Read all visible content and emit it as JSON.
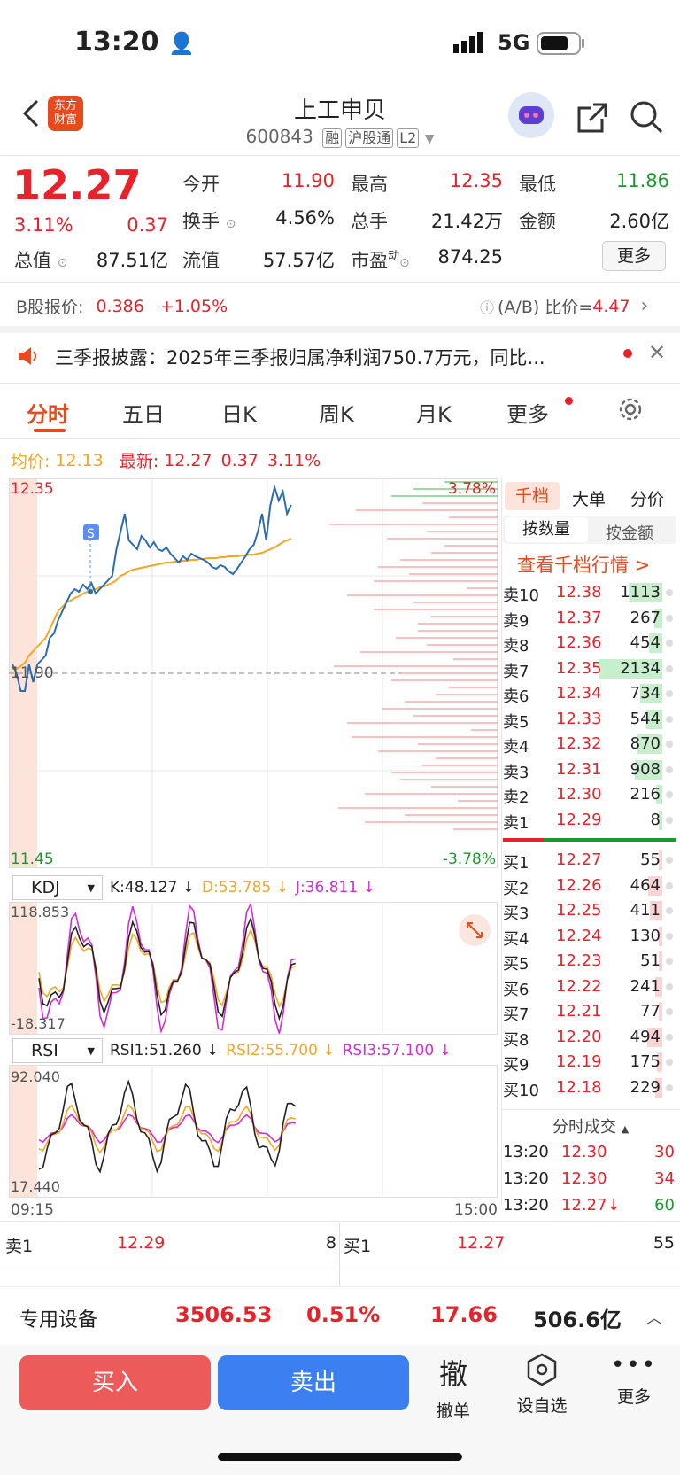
{
  "status": {
    "time": "13:20",
    "network": "5G"
  },
  "header": {
    "logo": "东方\n财富",
    "title": "上工申贝",
    "code": "600843",
    "tags": [
      "融",
      "沪股通",
      "L2"
    ]
  },
  "quote": {
    "price": "12.27",
    "pct": "3.11%",
    "chg": "0.37",
    "open_label": "今开",
    "open": "11.90",
    "high_label": "最高",
    "high": "12.35",
    "low_label": "最低",
    "low": "11.86",
    "turnover_label": "换手",
    "turnover": "4.56%",
    "volume_label": "总手",
    "volume": "21.42万",
    "amount_label": "金额",
    "amount": "2.60亿",
    "mktcap_label": "总值",
    "mktcap": "87.51亿",
    "float_label": "流值",
    "float": "57.57亿",
    "pe_label": "市盈",
    "pe_sup": "动",
    "pe": "874.25",
    "more_label": "更多"
  },
  "bshare": {
    "label": "B股报价:",
    "price": "0.386",
    "pct": "+1.05%",
    "ratio_label": "(A/B) 比价=",
    "ratio": "4.47"
  },
  "notice": {
    "text": "三季报披露：2025年三季报归属净利润750.7万元，同比..."
  },
  "tabs": [
    "分时",
    "五日",
    "日K",
    "周K",
    "月K",
    "更多"
  ],
  "chart_info": {
    "avg_label": "均价:",
    "avg": "12.13",
    "last_label": "最新:",
    "last": "12.27",
    "chg": "0.37",
    "pct": "3.11%"
  },
  "chart_axis": {
    "top": "12.35",
    "mid": "11.90",
    "bottom": "11.45",
    "top_pct": "3.78%",
    "bottom_pct": "-3.78%",
    "t_start": "09:15",
    "t_end": "15:00"
  },
  "kdj": {
    "name": "KDJ",
    "k": "K:48.127 ↓",
    "d": "D:53.785 ↓",
    "j": "J:36.811 ↓",
    "max": "118.853",
    "min": "-18.317"
  },
  "rsi": {
    "name": "RSI",
    "r1": "RSI1:51.260 ↓",
    "r2": "RSI2:55.700 ↓",
    "r3": "RSI3:57.100 ↓",
    "max": "92.040",
    "min": "17.440"
  },
  "orderbook": {
    "tabs": [
      "千档",
      "大单",
      "分价"
    ],
    "sub_tabs": [
      "按数量",
      "按金额"
    ],
    "link": "查看千档行情 >",
    "asks": [
      {
        "label": "卖10",
        "price": "12.38",
        "vol": "1113"
      },
      {
        "label": "卖9",
        "price": "12.37",
        "vol": "267"
      },
      {
        "label": "卖8",
        "price": "12.36",
        "vol": "454"
      },
      {
        "label": "卖7",
        "price": "12.35",
        "vol": "2134"
      },
      {
        "label": "卖6",
        "price": "12.34",
        "vol": "734"
      },
      {
        "label": "卖5",
        "price": "12.33",
        "vol": "544"
      },
      {
        "label": "卖4",
        "price": "12.32",
        "vol": "870"
      },
      {
        "label": "卖3",
        "price": "12.31",
        "vol": "908"
      },
      {
        "label": "卖2",
        "price": "12.30",
        "vol": "216"
      },
      {
        "label": "卖1",
        "price": "12.29",
        "vol": "8"
      }
    ],
    "bids": [
      {
        "label": "买1",
        "price": "12.27",
        "vol": "55"
      },
      {
        "label": "买2",
        "price": "12.26",
        "vol": "464"
      },
      {
        "label": "买3",
        "price": "12.25",
        "vol": "411"
      },
      {
        "label": "买4",
        "price": "12.24",
        "vol": "130"
      },
      {
        "label": "买5",
        "price": "12.23",
        "vol": "51"
      },
      {
        "label": "买6",
        "price": "12.22",
        "vol": "241"
      },
      {
        "label": "买7",
        "price": "12.21",
        "vol": "77"
      },
      {
        "label": "买8",
        "price": "12.20",
        "vol": "494"
      },
      {
        "label": "买9",
        "price": "12.19",
        "vol": "175"
      },
      {
        "label": "买10",
        "price": "12.18",
        "vol": "229"
      }
    ]
  },
  "trades": {
    "title": "分时成交",
    "rows": [
      {
        "time": "13:20",
        "price": "12.30",
        "vol": "30"
      },
      {
        "time": "13:20",
        "price": "12.30",
        "vol": "34"
      },
      {
        "time": "13:20",
        "price": "12.27↓",
        "vol": "60"
      }
    ]
  },
  "bottom_quote": {
    "sell_label": "卖1",
    "sell_price": "12.29",
    "sell_vol": "8",
    "buy_label": "买1",
    "buy_price": "12.27",
    "buy_vol": "55"
  },
  "sector": {
    "name": "专用设备",
    "index": "3506.53",
    "pct": "0.51%",
    "pe": "17.66",
    "amount": "506.6亿"
  },
  "actions": {
    "buy": "买入",
    "sell": "卖出",
    "cancel_big": "撤",
    "cancel": "撤单",
    "watch": "设自选",
    "more": "更多"
  },
  "colors": {
    "up": "#e8212a",
    "down": "#1a9a2d",
    "accent": "#e8491d",
    "avg_line": "#f5a623",
    "price_line": "#2b6cb0",
    "buy_button": "#ec5a5a",
    "sell_button": "#3b7ff0"
  }
}
